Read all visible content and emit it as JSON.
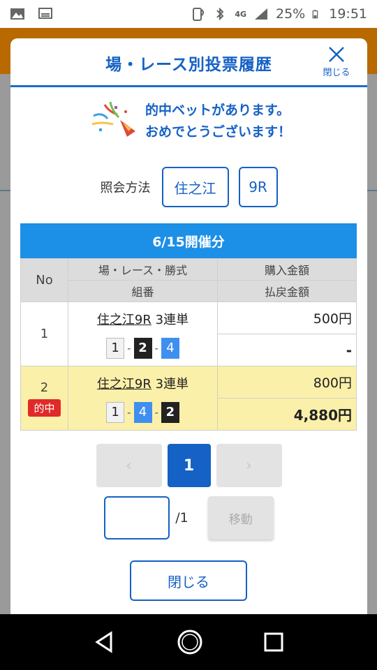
{
  "status_bar": {
    "battery": "25%",
    "time": "19:51",
    "network": "4G"
  },
  "modal": {
    "title": "場・レース別投票履歴",
    "close_label": "閉じる",
    "congrats_line1": "的中ベットがあります。",
    "congrats_line2": "おめでとうございます！",
    "lookup_label": "照会方法",
    "venue": "住之江",
    "race": "9R",
    "table": {
      "date_header": "6/15開催分",
      "col_no": "No",
      "col_race": "場・レース・勝式",
      "col_purchase": "購入金額",
      "col_combo": "組番",
      "col_payout": "払戻金額",
      "rows": [
        {
          "no": "1",
          "race_link": "住之江9R",
          "bet_type": "3連単",
          "combo": [
            "1",
            "2",
            "4"
          ],
          "purchase": "500円",
          "payout": "-",
          "hit": false
        },
        {
          "no": "2",
          "race_link": "住之江9R",
          "bet_type": "3連単",
          "combo": [
            "1",
            "4",
            "2"
          ],
          "purchase": "800円",
          "payout": "4,880円",
          "hit": true,
          "hit_label": "的中"
        }
      ],
      "combo_sep": "-"
    },
    "pager": {
      "prev": "‹",
      "current": "1",
      "next": "›"
    },
    "jump": {
      "value": "",
      "total": "/1",
      "move_label": "移動"
    },
    "close_button": "閉じる"
  },
  "colors": {
    "accent": "#1561c5",
    "header_bar": "#1c8fe6",
    "hit_row": "#fbf0a9",
    "hit_badge": "#e02a2a"
  }
}
